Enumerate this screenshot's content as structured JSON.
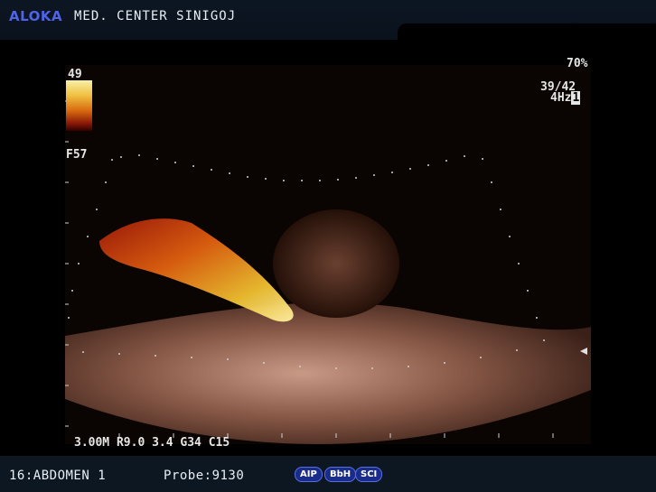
{
  "header": {
    "brand": "ALOKA",
    "hospital": "MED. CENTER SINIGOJ"
  },
  "overlay": {
    "colorbar_max": "49",
    "frequency_tag": "F57",
    "gain_percent": "70%",
    "frame_count": "39/42",
    "rate": "4Hz",
    "rate_box": "1",
    "params": "3.00M R9.0 3.4 G34 C15"
  },
  "footer": {
    "preset": "16:ABDOMEN 1",
    "probe": "Probe:9130",
    "modes": [
      "AIP",
      "BbH",
      "SCI"
    ]
  },
  "colors": {
    "brand": "#4f63e8",
    "badge": "#1a2c8a"
  }
}
